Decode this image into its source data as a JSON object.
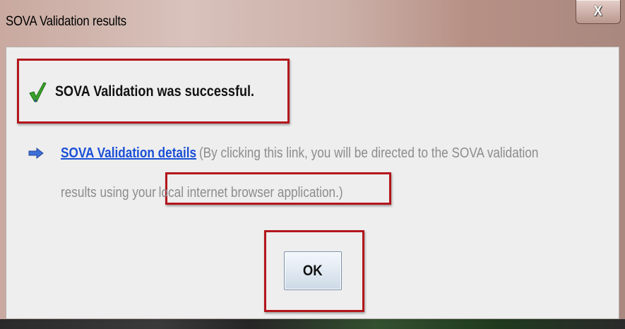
{
  "window": {
    "title": "SOVA Validation results",
    "close_glyph": "X"
  },
  "dialog": {
    "success_message": "SOVA Validation was successful.",
    "success_icon": "check-icon",
    "details_icon": "arrow-right-icon",
    "details_link": "SOVA Validation details",
    "details_text_line1": "(By clicking this link, you will be directed to the SOVA validation",
    "details_text_line2_a": "results using your",
    "details_text_line2_b": "local internet browser application.)",
    "ok_label": "OK"
  },
  "colors": {
    "highlight": "#b3161c",
    "link": "#1a4fd6",
    "check": "#3aa32a"
  }
}
